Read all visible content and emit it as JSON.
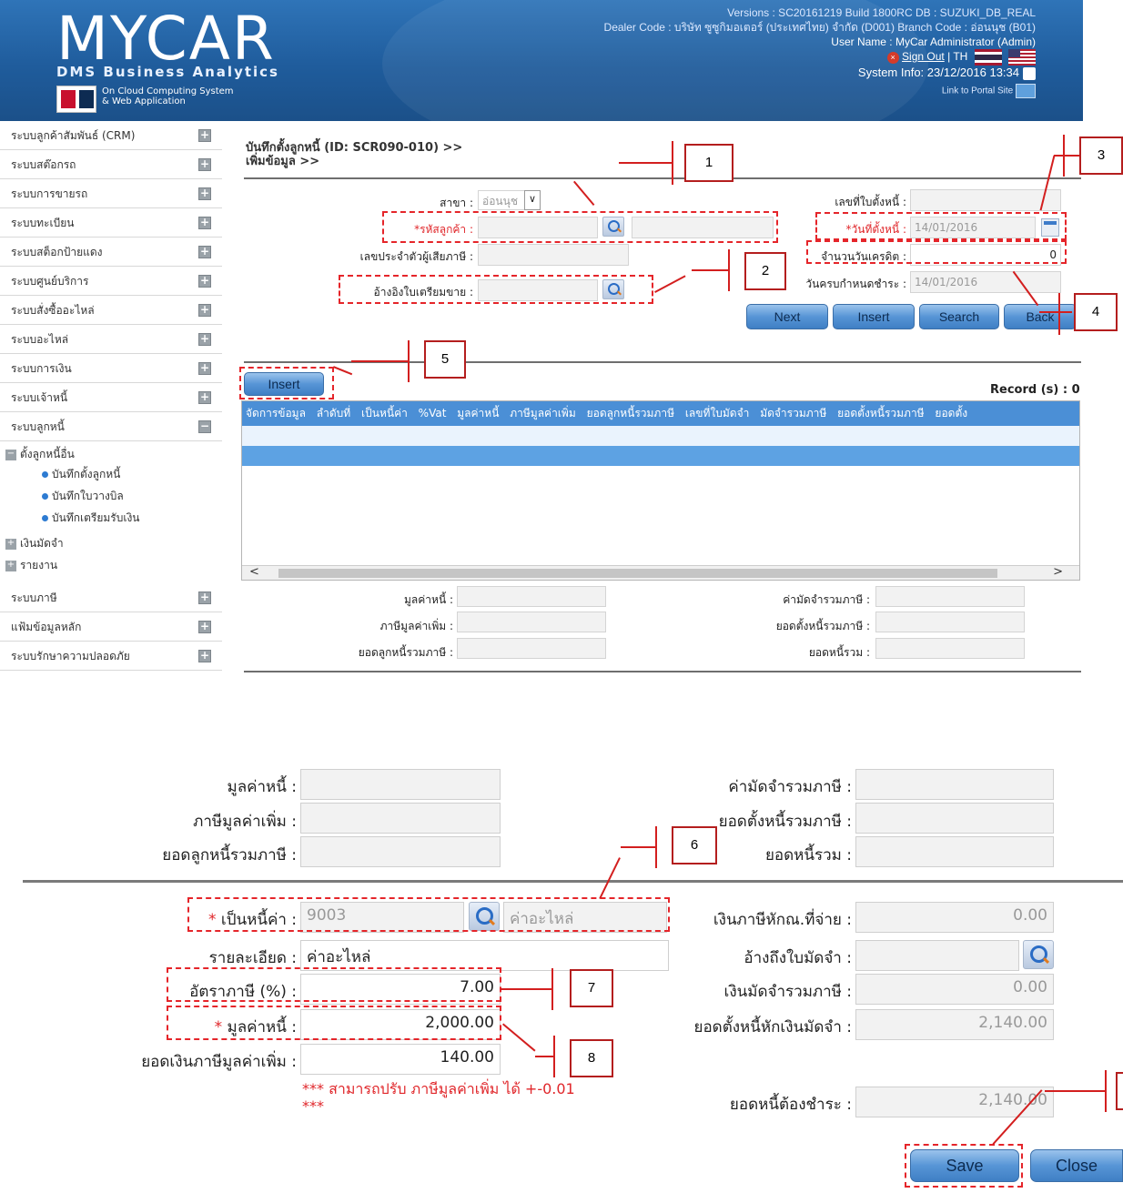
{
  "header": {
    "logo": "MYCAR",
    "logo_sub": "DMS Business Analytics",
    "logo_tag_1": "On Cloud Computing System",
    "logo_tag_2": "& Web Application",
    "version": "Versions : SC20161219 Build 1800RC DB : SUZUKI_DB_REAL",
    "dealer": "Dealer Code : บริษัท ซูซูกิมอเตอร์ (ประเทศไทย) จำกัด (D001) Branch Code : อ่อนนุช (B01)",
    "user": "User Name : MyCar Administrator (Admin)",
    "sign_out": "Sign Out",
    "lang": "| TH",
    "system_info": "System Info: 23/12/2016 13:34",
    "portal": "Link to Portal Site"
  },
  "sidebar": {
    "items": [
      {
        "label": "ระบบลูกค้าสัมพันธ์ (CRM)",
        "icon": "+"
      },
      {
        "label": "ระบบสต๊อกรถ",
        "icon": "+"
      },
      {
        "label": "ระบบการขายรถ",
        "icon": "+"
      },
      {
        "label": "ระบบทะเบียน",
        "icon": "+"
      },
      {
        "label": "ระบบสต็อกป้ายแดง",
        "icon": "+"
      },
      {
        "label": "ระบบศูนย์บริการ",
        "icon": "+"
      },
      {
        "label": "ระบบสั่งซื้ออะไหล่",
        "icon": "+"
      },
      {
        "label": "ระบบอะไหล่",
        "icon": "+"
      },
      {
        "label": "ระบบการเงิน",
        "icon": "+"
      },
      {
        "label": "ระบบเจ้าหนี้",
        "icon": "+"
      },
      {
        "label": "ระบบลูกหนี้",
        "icon": "−"
      }
    ],
    "sub": {
      "group1": "ตั้งลูกหนี้อื่น",
      "leaf1": "บันทึกตั้งลูกหนี้",
      "leaf2": "บันทึกใบวางบิล",
      "leaf3": "บันทึกเตรียมรับเงิน",
      "group2": "เงินมัดจำ",
      "group3": "รายงาน"
    },
    "items_bottom": [
      {
        "label": "ระบบภาษี",
        "icon": "+"
      },
      {
        "label": "แฟ้มข้อมูลหลัก",
        "icon": "+"
      },
      {
        "label": "ระบบรักษาความปลอดภัย",
        "icon": "+"
      }
    ]
  },
  "breadcrumb": {
    "line1": "บันทึกตั้งลูกหนี้ (ID: SCR090-010) >>",
    "line2": "เพิ่มข้อมูล >>"
  },
  "form": {
    "branch_label": "สาขา :",
    "branch_value": "อ่อนนุช",
    "customer_label": "*รหัสลูกค้า :",
    "tax_id_label": "เลขประจำตัวผู้เสียภาษี :",
    "ref_label": "อ้างอิงใบเตรียมขาย :",
    "doc_no_label": "เลขที่ใบตั้งหนี้ :",
    "date_label": "*วันที่ตั้งหนี้ :",
    "date_value": "14/01/2016",
    "credit_days_label": "จำนวนวันเครดิต :",
    "credit_days_value": "0",
    "due_date_label": "วันครบกำหนดชำระ :",
    "due_date_value": "14/01/2016"
  },
  "buttons": {
    "next": "Next",
    "insert": "Insert",
    "search": "Search",
    "back": "Back",
    "grid_insert": "Insert",
    "save": "Save",
    "close": "Close"
  },
  "grid": {
    "record_label": "Record (s) : 0",
    "columns": [
      "จัดการข้อมูล",
      "ลำดับที่",
      "เป็นหนี้ค่า",
      "%Vat",
      "มูลค่าหนี้",
      "ภาษีมูลค่าเพิ่ม",
      "ยอดลูกหนี้รวมภาษี",
      "เลขที่ใบมัดจำ",
      "มัดจำรวมภาษี",
      "ยอดตั้งหนี้รวมภาษี",
      "ยอดตั้ง"
    ]
  },
  "summary": {
    "debt_value": "มูลค่าหนี้ :",
    "vat": "ภาษีมูลค่าเพิ่ม :",
    "total_with_tax": "ยอดลูกหนี้รวมภาษี :",
    "deposit_with_tax": "ค่ามัดจำรวมภาษี :",
    "setup_with_tax": "ยอดตั้งหนี้รวมภาษี :",
    "total_debt": "ยอดหนี้รวม :"
  },
  "detail": {
    "debt_for_label": "เป็นหนี้ค่า :",
    "debt_for_code": "9003",
    "debt_for_name": "ค่าอะไหล่",
    "description_label": "รายละเอียด :",
    "description_value": "ค่าอะไหล่",
    "tax_rate_label": "อัตราภาษี (%) :",
    "tax_rate_value": "7.00",
    "debt_value_label": "มูลค่าหนี้ :",
    "debt_value_value": "2,000.00",
    "vat_amount_label": "ยอดเงินภาษีมูลค่าเพิ่ม :",
    "vat_amount_value": "140.00",
    "warning": "*** สามารถปรับ ภาษีมูลค่าเพิ่ม ได้ +-0.01 ***",
    "wht_label": "เงินภาษีหักณ.ที่จ่าย :",
    "wht_value": "0.00",
    "deposit_ref_label": "อ้างถึงใบมัดจำ :",
    "deposit_tax_label": "เงินมัดจำรวมภาษี :",
    "deposit_tax_value": "0.00",
    "net_setup_label": "ยอดตั้งหนี้หักเงินมัดจำ :",
    "net_setup_value": "2,140.00",
    "payable_label": "ยอดหนี้ต้องชำระ :",
    "payable_value": "2,140.00"
  },
  "callouts": [
    "1",
    "2",
    "3",
    "4",
    "5",
    "6",
    "7",
    "8"
  ],
  "colors": {
    "header_blue": "#1f5c9c",
    "grid_header": "#4b8fd6",
    "annotation_red": "#e5252a",
    "required_red": "#e0262a"
  }
}
